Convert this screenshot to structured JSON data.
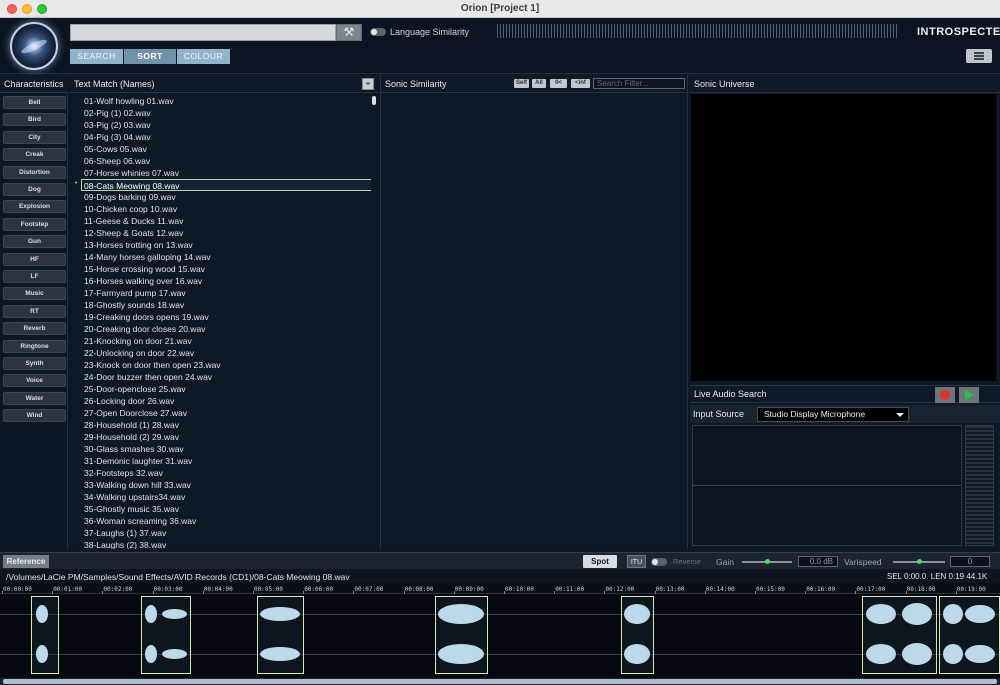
{
  "window": {
    "title": "Orion [Project 1]"
  },
  "header": {
    "search_value": "",
    "language_similarity_label": "Language Similarity",
    "language_similarity_on": false,
    "modes": [
      "SEARCH",
      "SORT",
      "COLOUR"
    ],
    "active_mode": "SORT",
    "brand": "INTROSPECTER"
  },
  "characteristics": {
    "title": "Characteristics",
    "items": [
      "Bell",
      "Bird",
      "City",
      "Creak",
      "Distortion",
      "Dog",
      "Explosion",
      "Footstep",
      "Gun",
      "HF",
      "LF",
      "Music",
      "RT",
      "Reverb",
      "Ringtone",
      "Synth",
      "Voice",
      "Water",
      "Wind"
    ]
  },
  "text_match": {
    "title": "Text Match (Names)",
    "selected_index": 7,
    "items": [
      "01-Wolf howling 01.wav",
      "02-Pig (1) 02.wav",
      "03-Pig (2) 03.wav",
      "04-Pig (3) 04.wav",
      "05-Cows 05.wav",
      "06-Sheep 06.wav",
      "07-Horse whinies 07.wav",
      "08-Cats Meowing 08.wav",
      "09-Dogs barking 09.wav",
      "10-Chicken coop 10.wav",
      "11-Geese & Ducks 11.wav",
      "12-Sheep & Goats 12.wav",
      "13-Horses trotting on 13.wav",
      "14-Many horses galloping 14.wav",
      "15-Horse crossing wood 15.wav",
      "16-Horses walking over 16.wav",
      "17-Farmyard pump 17.wav",
      "18-Ghostly sounds 18.wav",
      "19-Creaking doors opens 19.wav",
      "20-Creaking door closes 20.wav",
      "21-Knocking on door 21.wav",
      "22-Unlocking on  door 22.wav",
      "23-Knock on door then open 23.wav",
      "24-Door buzzer then open 24.wav",
      "25-Door-openclose 25.wav",
      "26-Locking door 26.wav",
      "27-Open Doorclose 27.wav",
      "28-Household (1) 28.wav",
      "29-Household (2) 29.wav",
      "30-Glass smashes 30.wav",
      "31-Demonic laughter 31.wav",
      "32-Footsteps 32.wav",
      "33-Walking down hill 33.wav",
      "34-Walking upstairs34.wav",
      "35-Ghostly music  35.wav",
      "36-Woman screaming 36.wav",
      "37-Laughs (1) 37.wav",
      "38-Laughs (2) 38.wav"
    ]
  },
  "sonic_similarity": {
    "title": "Sonic Similarity",
    "chips": [
      "Self",
      "All",
      "0<",
      "<inf"
    ],
    "filter_placeholder": "Search Filter..."
  },
  "sonic_universe": {
    "title": "Sonic Universe"
  },
  "live_audio_search": {
    "title": "Live Audio Search",
    "input_source_label": "Input Source",
    "input_source_value": "Studio Display Microphone"
  },
  "transport": {
    "reference_label": "Reference",
    "spot_label": "Spot",
    "itu_label": "ITU",
    "reverse_label": "Reverse",
    "gain_label": "Gain",
    "gain_value": "0.0 dB",
    "gain_level": 0.5,
    "varispeed_label": "Varispeed",
    "varispeed_value": "0",
    "varispeed_level": 0.5
  },
  "file": {
    "path": "/Volumes/LaCie PM/Samples/Sound Effects/AVID Records (CD1)/08-Cats Meowing 08.wav",
    "sel": "SEL 0:00.0",
    "len": "LEN 0:19",
    "rate": "44.1K"
  },
  "timeline": {
    "ticks": [
      "00:00:00",
      "00:01:00",
      "00:02:00",
      "00:03:00",
      "00:04:00",
      "00:05:00",
      "00:06:00",
      "00:07:00",
      "00:08:00",
      "00:09:00",
      "00:10:00",
      "00:11:00",
      "00:12:00",
      "00:13:00",
      "00:14:00",
      "00:15:00",
      "00:16:00",
      "00:17:00",
      "00:18:00",
      "00:19:00"
    ]
  },
  "colors": {
    "background": "#0e1724",
    "accent_button": "#8fb3c8",
    "selection_border": "#b9d4a0",
    "waveform": "#bcd9ea",
    "record": "#e0322c",
    "play": "#27c24a"
  }
}
